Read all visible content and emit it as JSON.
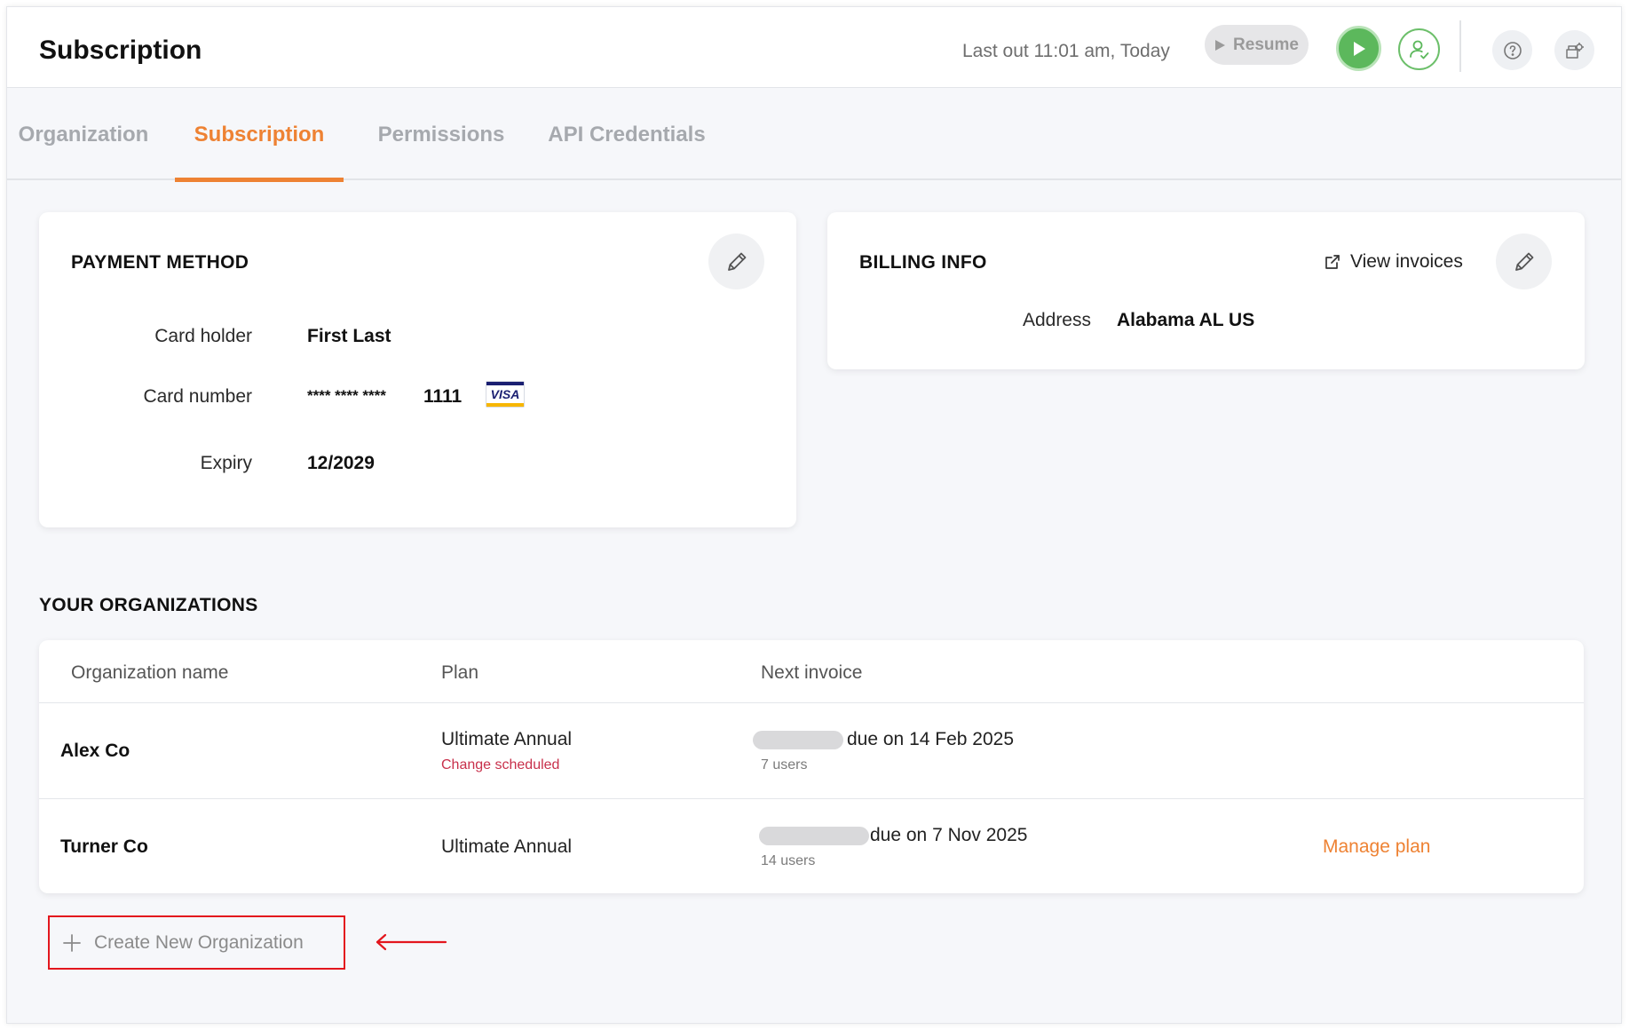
{
  "header": {
    "title": "Subscription",
    "last_out": "Last out 11:01 am, Today",
    "resume_label": "Resume"
  },
  "tabs": [
    {
      "label": "Organization",
      "active": false
    },
    {
      "label": "Subscription",
      "active": true
    },
    {
      "label": "Permissions",
      "active": false
    },
    {
      "label": "API Credentials",
      "active": false
    }
  ],
  "payment_method": {
    "title": "PAYMENT METHOD",
    "card_holder_label": "Card holder",
    "card_holder_value": "First Last",
    "card_number_label": "Card number",
    "card_number_mask": "**** **** ****",
    "card_number_last4": "1111",
    "card_brand": "VISA",
    "expiry_label": "Expiry",
    "expiry_value": "12/2029"
  },
  "billing_info": {
    "title": "BILLING INFO",
    "view_invoices_label": "View invoices",
    "address_label": "Address",
    "address_value": "Alabama AL US"
  },
  "organizations": {
    "title": "YOUR ORGANIZATIONS",
    "columns": [
      "Organization name",
      "Plan",
      "Next invoice"
    ],
    "rows": [
      {
        "name": "Alex Co",
        "plan": "Ultimate Annual",
        "plan_note": "Change scheduled",
        "due": "due on 14 Feb 2025",
        "users": "7 users",
        "action": ""
      },
      {
        "name": "Turner Co",
        "plan": "Ultimate Annual",
        "plan_note": "",
        "due": "due on 7 Nov 2025",
        "users": "14 users",
        "action": "Manage plan"
      }
    ],
    "create_label": "Create New Organization"
  },
  "colors": {
    "accent": "#ee8233",
    "green": "#5cb85c",
    "annotation_red": "#e3161d",
    "warning_text": "#c8304b"
  },
  "icons": [
    "play-icon",
    "user-check-icon",
    "help-icon",
    "settings-icon",
    "pencil-icon",
    "external-link-icon",
    "plus-icon",
    "arrow-left-icon"
  ]
}
